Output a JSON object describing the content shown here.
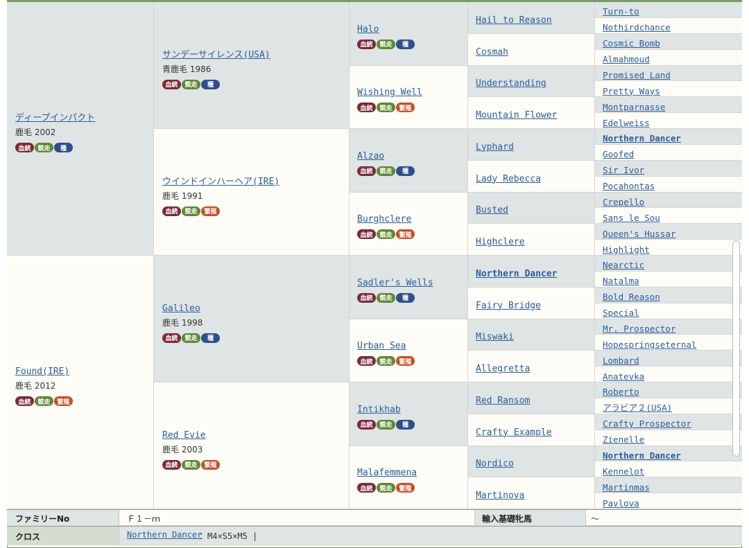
{
  "horse": {
    "name": "ディープインパクト",
    "info": "鹿毛 2002",
    "badges": [
      "血統",
      "競走",
      "種"
    ]
  },
  "dam": {
    "name": "Found(IRE)",
    "info": "鹿毛 2012",
    "badges": [
      "血統",
      "競走",
      "繁殖"
    ]
  },
  "gen2": [
    {
      "name": "サンデーサイレンス(USA)",
      "info": "青鹿毛 1986",
      "badges": [
        "血統",
        "競走",
        "種"
      ]
    },
    {
      "name": "ウインドインハーヘア(IRE)",
      "info": "鹿毛 1991",
      "badges": [
        "血統",
        "競走",
        "繁殖"
      ]
    },
    {
      "name": "Galileo",
      "info": "鹿毛 1998",
      "badges": [
        "血統",
        "競走",
        "種"
      ]
    },
    {
      "name": "Red Evie",
      "info": "鹿毛 2003",
      "badges": [
        "血統",
        "競走",
        "繁殖"
      ]
    }
  ],
  "gen3": [
    {
      "name": "Halo",
      "badges": [
        "血統",
        "競走",
        "種"
      ]
    },
    {
      "name": "Wishing Well",
      "badges": [
        "血統",
        "競走",
        "繁殖"
      ]
    },
    {
      "name": "Alzao",
      "badges": [
        "血統",
        "競走",
        "種"
      ]
    },
    {
      "name": "Burghclere",
      "badges": [
        "血統",
        "競走",
        "繁殖"
      ]
    },
    {
      "name": "Sadler's Wells",
      "badges": [
        "血統",
        "競走",
        "種"
      ]
    },
    {
      "name": "Urban Sea",
      "badges": [
        "血統",
        "競走",
        "繁殖"
      ]
    },
    {
      "name": "Intikhab",
      "badges": [
        "血統",
        "競走",
        "種"
      ]
    },
    {
      "name": "Malafemmena",
      "badges": [
        "血統",
        "競走",
        "繁殖"
      ]
    }
  ],
  "gen4": [
    "Hail to Reason",
    "Cosmah",
    "Understanding",
    "Mountain Flower",
    "Lyphard",
    "Lady Rebecca",
    "Busted",
    "Highclere",
    "Northern Dancer",
    "Fairy Bridge",
    "Miswaki",
    "Allegretta",
    "Red Ransom",
    "Crafty Example",
    "Nordico",
    "Martinova"
  ],
  "gen5": [
    "Turn-to",
    "Nothirdchance",
    "Cosmic Bomb",
    "Almahmoud",
    "Promised Land",
    "Pretty Ways",
    "Montparnasse",
    "Edelweiss",
    "Northern Dancer",
    "Goofed",
    "Sir Ivor",
    "Pocahontas",
    "Crepello",
    "Sans le Sou",
    "Queen's Hussar",
    "Highlight",
    "Nearctic",
    "Natalma",
    "Bold Reason",
    "Special",
    "Mr. Prospector",
    "Hopespringseternal",
    "Lombard",
    "Anatevka",
    "Roberto",
    "アラビア２(USA)",
    "Crafty Prospector",
    "Zienelle",
    "Northern Dancer",
    "Kennelot",
    "Martinmas",
    "Pavlova"
  ],
  "bottom": {
    "family_label": "ファミリーNo",
    "family_value": "Ｆ１－ｍ",
    "import_label": "輸入基礎牝馬",
    "import_value": "～",
    "cross_label": "クロス",
    "cross_link": "Northern Dancer",
    "cross_value": "：M4×S5×M5 |"
  }
}
